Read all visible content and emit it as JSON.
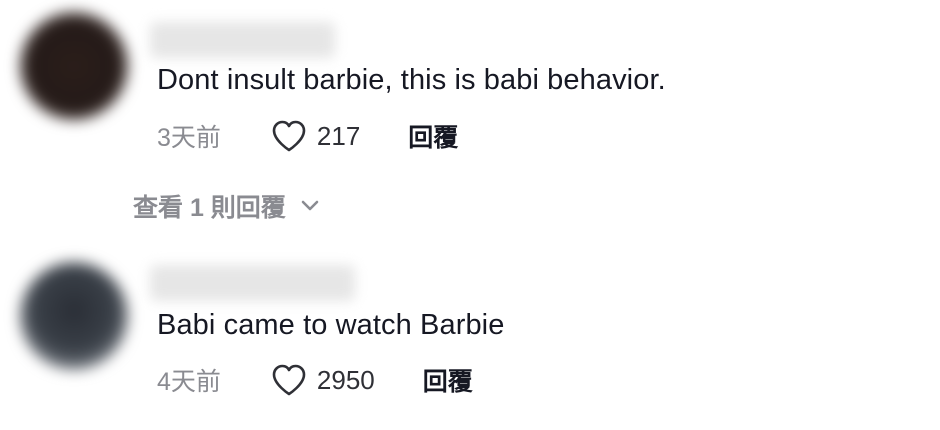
{
  "comments": [
    {
      "text": "Dont insult barbie, this is babi behavior.",
      "time": "3天前",
      "likes": "217",
      "reply_label": "回覆",
      "view_replies_label": "查看 1 則回覆"
    },
    {
      "text": "Babi came to watch Barbie",
      "time": "4天前",
      "likes": "2950",
      "reply_label": "回覆"
    }
  ],
  "icons": {
    "like": "heart-outline-icon",
    "expand": "chevron-down-icon"
  },
  "colors": {
    "text_primary": "#161823",
    "text_secondary": "#8a8b91",
    "background": "#ffffff"
  }
}
